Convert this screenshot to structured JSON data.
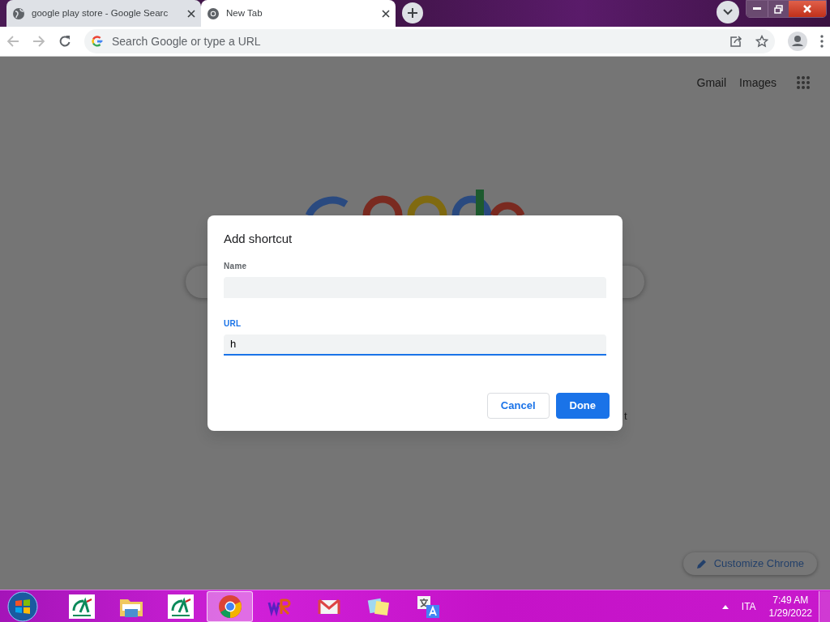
{
  "tabs": [
    {
      "title": "google play store - Google Searc",
      "kind": "globe",
      "selected": false
    },
    {
      "title": "New Tab",
      "kind": "chrome",
      "selected": true
    }
  ],
  "omnibox": {
    "placeholder": "Search Google or type a URL"
  },
  "top_links": [
    "Gmail",
    "Images"
  ],
  "hidden_tile_text": "t",
  "dialog": {
    "title": "Add shortcut",
    "fields": [
      {
        "label": "Name",
        "focused": false
      },
      {
        "label": "URL",
        "value": "h",
        "focused": true
      }
    ],
    "buttons": [
      {
        "label": "Cancel",
        "kind": "secondary"
      },
      {
        "label": "Done",
        "kind": "primary"
      }
    ]
  },
  "customize_button": "Customize Chrome",
  "taskbar": {
    "apps": [
      {
        "kind": "bank",
        "selected": false
      },
      {
        "kind": "folder",
        "selected": false
      },
      {
        "kind": "bank",
        "selected": false
      },
      {
        "kind": "chrome",
        "selected": true
      },
      {
        "kind": "dictionary",
        "selected": false
      },
      {
        "kind": "mail",
        "selected": false
      },
      {
        "kind": "notes",
        "selected": false
      },
      {
        "kind": "translate",
        "selected": false
      }
    ],
    "language": "ITA",
    "time": "7:49 AM",
    "date": "1/29/2022"
  }
}
